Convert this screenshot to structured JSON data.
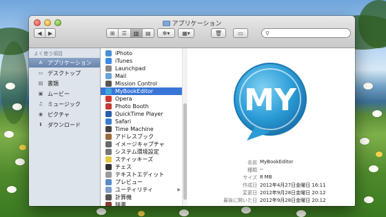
{
  "window": {
    "title": "アプリケーション"
  },
  "toolbar": {
    "back_label": "◀",
    "forward_label": "▶",
    "view_icon": "⊞",
    "list_icon": "☰",
    "column_icon": "▥",
    "coverflow_icon": "▤",
    "action_label": "✻▾",
    "arrange_label": "▦▾",
    "trash_icon": "🗑",
    "folder_icon": "▭",
    "search_placeholder": ""
  },
  "sidebar": {
    "heading": "よく使う項目",
    "items": [
      {
        "label": "アプリケーション",
        "icon": "A",
        "selected": true
      },
      {
        "label": "デスクトップ",
        "icon": "▭"
      },
      {
        "label": "書類",
        "icon": "▤"
      },
      {
        "label": "ムービー",
        "icon": "▣"
      },
      {
        "label": "ミュージック",
        "icon": "♫"
      },
      {
        "label": "ピクチャ",
        "icon": "◉"
      },
      {
        "label": "ダウンロード",
        "icon": "⬇"
      }
    ]
  },
  "files": [
    {
      "label": "iPhoto",
      "color": "#4d8fd1"
    },
    {
      "label": "iTunes",
      "color": "#3b8ae6"
    },
    {
      "label": "Launchpad",
      "color": "#888888"
    },
    {
      "label": "Mail",
      "color": "#6aa4d8"
    },
    {
      "label": "Mission Control",
      "color": "#555555"
    },
    {
      "label": "MyBookEditor",
      "color": "#3fa8da",
      "selected": true
    },
    {
      "label": "Opera",
      "color": "#d0342c"
    },
    {
      "label": "Photo Booth",
      "color": "#c23a36"
    },
    {
      "label": "QuickTime Player",
      "color": "#2a5ea8"
    },
    {
      "label": "Safari",
      "color": "#3b7fd0"
    },
    {
      "label": "Time Machine",
      "color": "#444444"
    },
    {
      "label": "アドレスブック",
      "color": "#9c6a3c"
    },
    {
      "label": "イメージキャプチャ",
      "color": "#6a6a6a"
    },
    {
      "label": "システム環境設定",
      "color": "#777777"
    },
    {
      "label": "スティッキーズ",
      "color": "#e6c542"
    },
    {
      "label": "チェス",
      "color": "#333333"
    },
    {
      "label": "テキストエディット",
      "color": "#9a9a9a"
    },
    {
      "label": "プレビュー",
      "color": "#5a8bc6"
    },
    {
      "label": "ユーティリティ",
      "color": "#7f9ec7",
      "folder": true
    },
    {
      "label": "計算機",
      "color": "#555555"
    },
    {
      "label": "辞書",
      "color": "#8b3a2f"
    }
  ],
  "preview": {
    "logo_text": "MY",
    "meta": [
      {
        "key": "名前",
        "value": "MyBookEditor"
      },
      {
        "key": "種類",
        "value": "--"
      },
      {
        "key": "サイズ",
        "value": "8 MB"
      },
      {
        "key": "作成日",
        "value": "2012年4月27日金曜日 16:11"
      },
      {
        "key": "変更日",
        "value": "2012年9月28日金曜日 20:12"
      },
      {
        "key": "最後に開いた日",
        "value": "2012年9月28日金曜日 20:12"
      },
      {
        "key": "バージョン",
        "value": "--"
      }
    ]
  },
  "colors": {
    "selection": "#3875d7",
    "logo_blue": "#2fa0d8"
  }
}
